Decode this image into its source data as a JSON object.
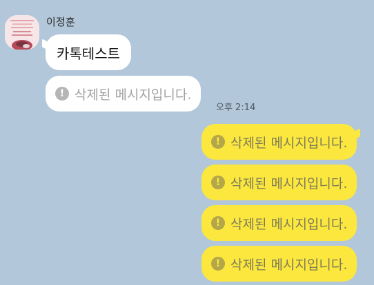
{
  "chat": {
    "sender": {
      "name": "이정훈",
      "avatar_icon": "profile-photo"
    },
    "incoming": {
      "text_message": "카톡테스트",
      "deleted_message": "삭제된 메시지입니다.",
      "time": "오후 2:14"
    },
    "outgoing": {
      "deleted_messages": [
        "삭제된 메시지입니다.",
        "삭제된 메시지입니다.",
        "삭제된 메시지입니다.",
        "삭제된 메시지입니다."
      ]
    },
    "warning_glyph": "!",
    "colors": {
      "background": "#b2c7da",
      "incoming_bubble": "#ffffff",
      "outgoing_bubble": "#fbe73e",
      "deleted_text_incoming": "#a2a2a2",
      "deleted_text_outgoing": "#7d7a5a"
    }
  }
}
